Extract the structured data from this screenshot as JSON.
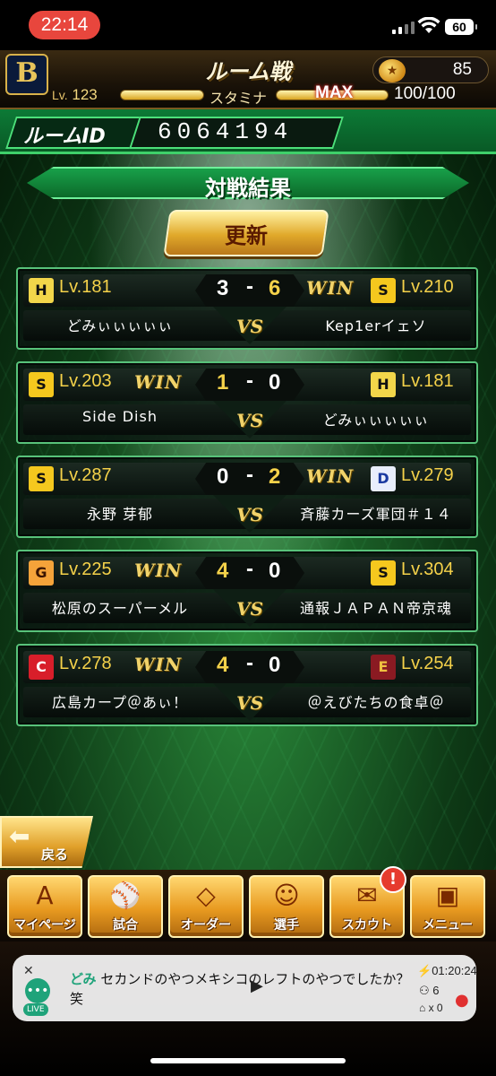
{
  "status_bar": {
    "time": "22:14",
    "battery": "60"
  },
  "header": {
    "team_logo": "B",
    "title": "ルーム戦",
    "coins": "85",
    "level_prefix": "Lv.",
    "level": "123",
    "stamina_label": "スタミナ",
    "stamina_max": "MAX",
    "stamina_value": "100/100"
  },
  "room": {
    "label": "ルームID",
    "id": "6064194"
  },
  "results": {
    "title": "対戦結果",
    "refresh_label": "更新",
    "win_label": "WIN",
    "vs_label": "VS",
    "matches": [
      {
        "left": {
          "team": "tigers",
          "emblem": "H",
          "level": "Lv.181",
          "name": "どみぃぃぃぃぃ"
        },
        "right": {
          "team": "hawks",
          "emblem": "S",
          "level": "Lv.210",
          "name": "Kep1erイェソ"
        },
        "left_score": "3",
        "right_score": "6",
        "winner": "right"
      },
      {
        "left": {
          "team": "hawks",
          "emblem": "S",
          "level": "Lv.203",
          "name": "Side Dish"
        },
        "right": {
          "team": "tigers",
          "emblem": "H",
          "level": "Lv.181",
          "name": "どみぃぃぃぃぃ"
        },
        "left_score": "1",
        "right_score": "0",
        "winner": "left"
      },
      {
        "left": {
          "team": "hawks",
          "emblem": "S",
          "level": "Lv.287",
          "name": "永野 芽郁"
        },
        "right": {
          "team": "dragons",
          "emblem": "D",
          "level": "Lv.279",
          "name": "斉藤カーズ軍団＃１４"
        },
        "left_score": "0",
        "right_score": "2",
        "winner": "right"
      },
      {
        "left": {
          "team": "giants",
          "emblem": "G",
          "level": "Lv.225",
          "name": "松原のスーパーメル"
        },
        "right": {
          "team": "hawks",
          "emblem": "S",
          "level": "Lv.304",
          "name": "通報ＪＡＰＡＮ帝京魂"
        },
        "left_score": "4",
        "right_score": "0",
        "winner": "left"
      },
      {
        "left": {
          "team": "carp",
          "emblem": "C",
          "level": "Lv.278",
          "name": "広島カープ＠あぃ！"
        },
        "right": {
          "team": "eagles",
          "emblem": "E",
          "level": "Lv.254",
          "name": "＠えびたちの食卓＠"
        },
        "left_score": "4",
        "right_score": "0",
        "winner": "left"
      }
    ]
  },
  "back_button": "戻る",
  "nav": [
    {
      "label": "マイページ",
      "icon": "letter-a-icon",
      "glyph": "A"
    },
    {
      "label": "試合",
      "icon": "stadium-icon",
      "glyph": "⚾"
    },
    {
      "label": "オーダー",
      "icon": "field-icon",
      "glyph": "◇"
    },
    {
      "label": "選手",
      "icon": "player-icon",
      "glyph": "☺"
    },
    {
      "label": "スカウト",
      "icon": "scout-icon",
      "glyph": "✉",
      "badge": "!"
    },
    {
      "label": "メニュー",
      "icon": "menu-character-icon",
      "glyph": "▣"
    }
  ],
  "live_comment": {
    "live_tag": "LIVE",
    "user": "どみ",
    "message": "セカンドのやつメキシコのレフトのやつでしたか？笑",
    "elapsed": "01:20:24",
    "viewers": "6",
    "gifts": "x 0"
  },
  "colors": {
    "accent_green": "#58c27a",
    "score_yellow": "#f5d24a",
    "gold": "#e0a82a",
    "live_red": "#e8463d"
  }
}
